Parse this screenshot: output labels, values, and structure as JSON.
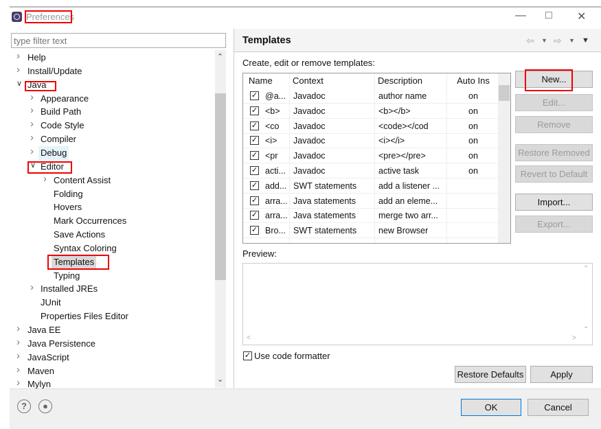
{
  "window": {
    "title": "Preferences"
  },
  "filter": {
    "placeholder": "type filter text"
  },
  "tree": [
    {
      "label": "Help",
      "level": 0,
      "arrow": "collapsed"
    },
    {
      "label": "Install/Update",
      "level": 0,
      "arrow": "collapsed"
    },
    {
      "label": "Java",
      "level": 0,
      "arrow": "expanded"
    },
    {
      "label": "Appearance",
      "level": 1,
      "arrow": "collapsed"
    },
    {
      "label": "Build Path",
      "level": 1,
      "arrow": "collapsed"
    },
    {
      "label": "Code Style",
      "level": 1,
      "arrow": "collapsed"
    },
    {
      "label": "Compiler",
      "level": 1,
      "arrow": "collapsed"
    },
    {
      "label": "Debug",
      "level": 1,
      "arrow": "collapsed",
      "hover": true
    },
    {
      "label": "Editor",
      "level": 1,
      "arrow": "expanded"
    },
    {
      "label": "Content Assist",
      "level": 2,
      "arrow": "collapsed"
    },
    {
      "label": "Folding",
      "level": 2,
      "arrow": ""
    },
    {
      "label": "Hovers",
      "level": 2,
      "arrow": ""
    },
    {
      "label": "Mark Occurrences",
      "level": 2,
      "arrow": ""
    },
    {
      "label": "Save Actions",
      "level": 2,
      "arrow": ""
    },
    {
      "label": "Syntax Coloring",
      "level": 2,
      "arrow": ""
    },
    {
      "label": "Templates",
      "level": 2,
      "arrow": "",
      "selected": true
    },
    {
      "label": "Typing",
      "level": 2,
      "arrow": ""
    },
    {
      "label": "Installed JREs",
      "level": 1,
      "arrow": "collapsed"
    },
    {
      "label": "JUnit",
      "level": 1,
      "arrow": ""
    },
    {
      "label": "Properties Files Editor",
      "level": 1,
      "arrow": ""
    },
    {
      "label": "Java EE",
      "level": 0,
      "arrow": "collapsed"
    },
    {
      "label": "Java Persistence",
      "level": 0,
      "arrow": "collapsed"
    },
    {
      "label": "JavaScript",
      "level": 0,
      "arrow": "collapsed"
    },
    {
      "label": "Maven",
      "level": 0,
      "arrow": "collapsed"
    },
    {
      "label": "Mylyn",
      "level": 0,
      "arrow": "collapsed"
    }
  ],
  "page": {
    "title": "Templates",
    "description": "Create, edit or remove templates:"
  },
  "table": {
    "columns": [
      "Name",
      "Context",
      "Description",
      "Auto Ins"
    ],
    "rows": [
      [
        "@a...",
        "Javadoc",
        "author name",
        "on"
      ],
      [
        "<b>",
        "Javadoc",
        "<b></b>",
        "on"
      ],
      [
        "<co",
        "Javadoc",
        "<code></cod",
        "on"
      ],
      [
        "<i>",
        "Javadoc",
        "<i></i>",
        "on"
      ],
      [
        "<pr",
        "Javadoc",
        "<pre></pre>",
        "on"
      ],
      [
        "acti...",
        "Javadoc",
        "active task",
        "on"
      ],
      [
        "add...",
        "SWT statements",
        "add a listener ...",
        ""
      ],
      [
        "arra...",
        "Java statements",
        "add an eleme...",
        ""
      ],
      [
        "arra...",
        "Java statements",
        "merge two arr...",
        ""
      ],
      [
        "Bro...",
        "SWT statements",
        "new Browser",
        ""
      ]
    ]
  },
  "buttons": {
    "new": "New...",
    "edit": "Edit...",
    "remove": "Remove",
    "restore_removed": "Restore Removed",
    "revert": "Revert to Default",
    "import": "Import...",
    "export": "Export..."
  },
  "preview_label": "Preview:",
  "use_formatter": {
    "label": "Use code formatter",
    "checked": true
  },
  "restore_defaults": "Restore Defaults",
  "apply": "Apply",
  "ok": "OK",
  "cancel": "Cancel",
  "colors": {
    "highlight": "#e00000",
    "selected": "#d9d9d9",
    "hover": "#e5f3fb"
  }
}
